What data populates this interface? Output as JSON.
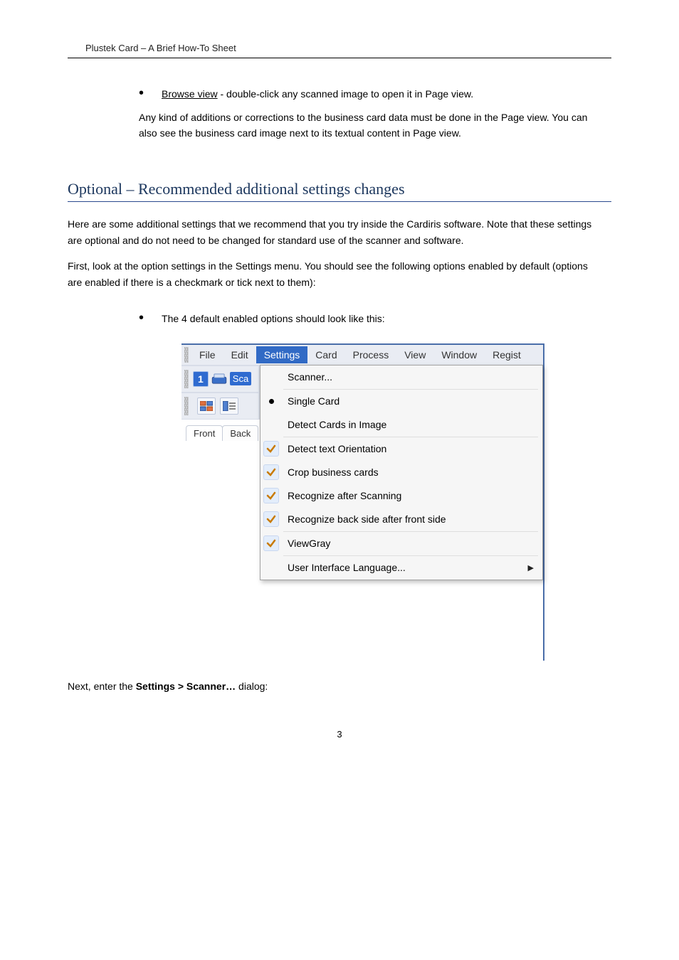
{
  "header": "Plustek Card – A Brief How-To Sheet",
  "bullet1": {
    "lead": "Browse view",
    "rest": " - double-click any scanned image to open it in Page view."
  },
  "para1": "Any kind of additions or corrections to the business card data must be done in the Page view. You can also see the business card image next to its textual content in Page view.",
  "sectionTitle": "Optional – Recommended additional settings changes",
  "p1": "Here are some additional settings that we recommend that you try inside the Cardiris software. Note that these settings are optional and do not need to be changed for standard use of the scanner and software.",
  "p2a": "First, look at the option settings in the ",
  "p2b": "Settings",
  "p2c": " menu. You should see the following options enabled by default (options are enabled if there is a checkmark or tick next to them):",
  "bullet2": "The 4 default enabled options should look like this:",
  "menu": {
    "file": "File",
    "edit": "Edit",
    "settings": "Settings",
    "card": "Card",
    "process": "Process",
    "view": "View",
    "window": "Window",
    "regis": "Regist"
  },
  "toolbar": {
    "one": "1",
    "scan": "Sca"
  },
  "tabs": {
    "front": "Front",
    "back": "Back"
  },
  "dropdown": {
    "scanner": "Scanner...",
    "singleCard": "Single Card",
    "detectCards": "Detect Cards in Image",
    "detectText": "Detect text Orientation",
    "crop": "Crop business cards",
    "recognizeAfter": "Recognize after Scanning",
    "recognizeBack": "Recognize back side after front side",
    "viewGray": "ViewGray",
    "uiLang": "User Interface Language..."
  },
  "foot_a": "Next, enter the ",
  "foot_b": "Settings > Scanner…",
  "foot_c": " dialog:",
  "pageNum": "3"
}
